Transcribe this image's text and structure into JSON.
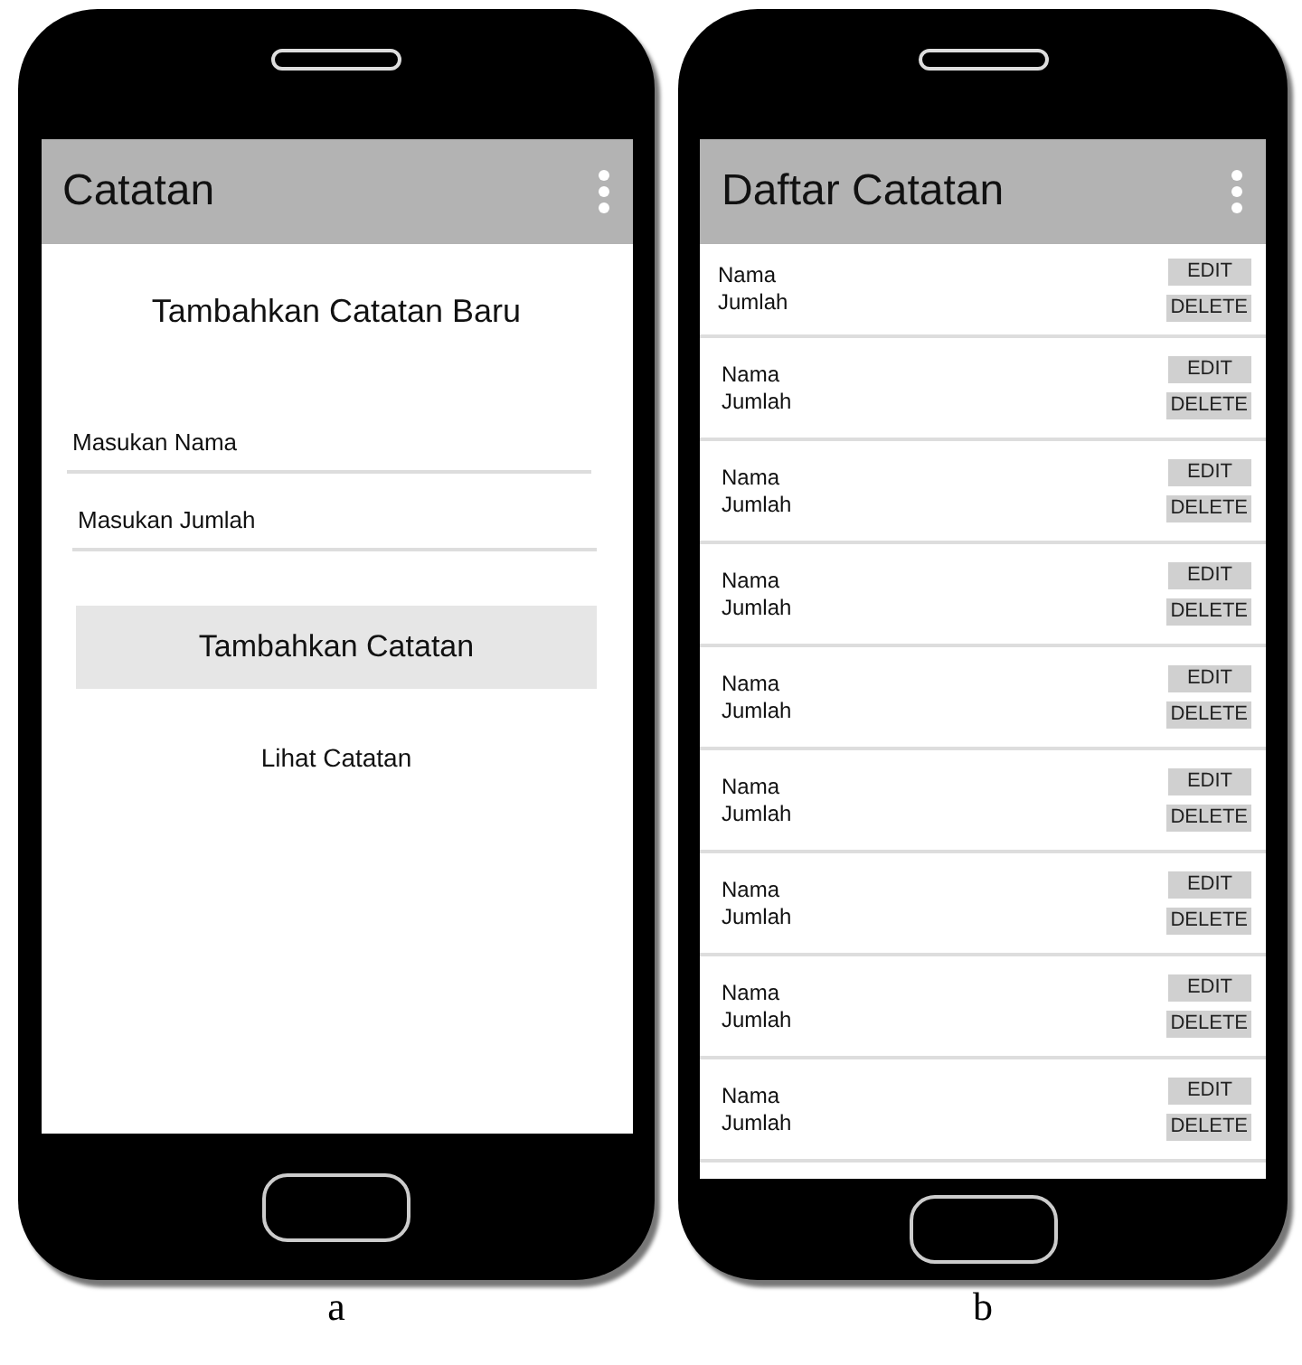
{
  "phones": [
    {
      "kind": "form",
      "caption": "a",
      "app_bar": {
        "title": "Catatan"
      },
      "heading": "Tambahkan Catatan Baru",
      "fields": [
        {
          "placeholder": "Masukan Nama"
        },
        {
          "placeholder": "Masukan Jumlah"
        }
      ],
      "button": "Tambahkan Catatan",
      "link": "Lihat Catatan"
    },
    {
      "kind": "list",
      "caption": "b",
      "app_bar": {
        "title": "Daftar Catatan"
      },
      "rows": [
        {
          "name": "Nama",
          "amount": "Jumlah",
          "edit": "EDIT",
          "delete": "DELETE"
        },
        {
          "name": "Nama",
          "amount": "Jumlah",
          "edit": "EDIT",
          "delete": "DELETE"
        },
        {
          "name": "Nama",
          "amount": "Jumlah",
          "edit": "EDIT",
          "delete": "DELETE"
        },
        {
          "name": "Nama",
          "amount": "Jumlah",
          "edit": "EDIT",
          "delete": "DELETE"
        },
        {
          "name": "Nama",
          "amount": "Jumlah",
          "edit": "EDIT",
          "delete": "DELETE"
        },
        {
          "name": "Nama",
          "amount": "Jumlah",
          "edit": "EDIT",
          "delete": "DELETE"
        },
        {
          "name": "Nama",
          "amount": "Jumlah",
          "edit": "EDIT",
          "delete": "DELETE"
        },
        {
          "name": "Nama",
          "amount": "Jumlah",
          "edit": "EDIT",
          "delete": "DELETE"
        },
        {
          "name": "Nama",
          "amount": "Jumlah",
          "edit": "EDIT",
          "delete": "DELETE"
        }
      ]
    }
  ]
}
